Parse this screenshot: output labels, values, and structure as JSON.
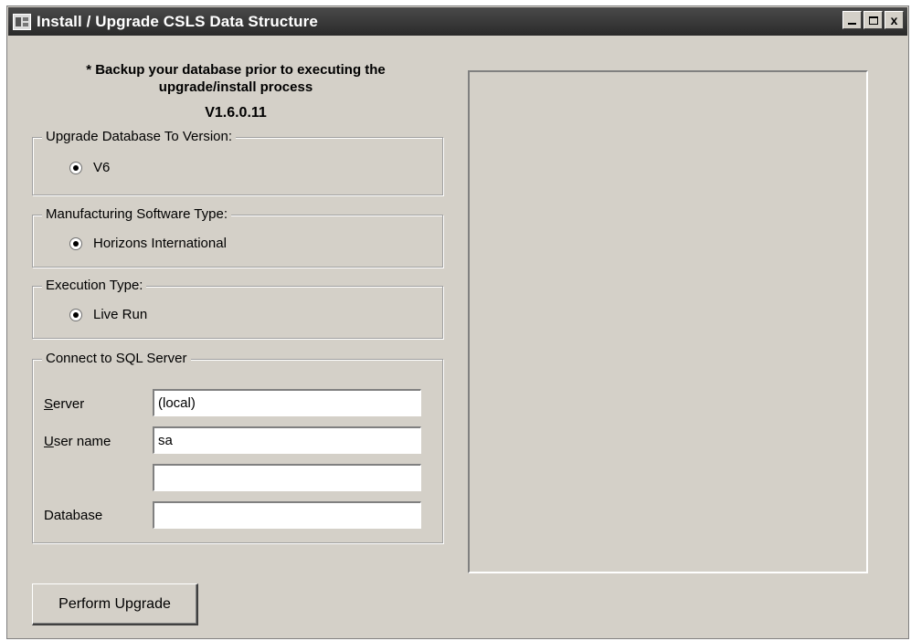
{
  "window": {
    "title": "Install / Upgrade CSLS Data Structure",
    "controls": {
      "minimize": "_",
      "maximize": "□",
      "close": "x"
    }
  },
  "notice": {
    "line1": "* Backup your database prior to executing the",
    "line2": "upgrade/install process"
  },
  "version": "V1.6.0.11",
  "groups": {
    "upgrade_version": {
      "title": "Upgrade Database To Version:",
      "option": "V6",
      "selected": true
    },
    "software_type": {
      "title": "Manufacturing Software Type:",
      "option": "Horizons International",
      "selected": true
    },
    "execution_type": {
      "title": "Execution Type:",
      "option": "Live Run",
      "selected": true
    }
  },
  "sql": {
    "title": "Connect to SQL Server",
    "server_label_accel": "S",
    "server_label_rest": "erver",
    "server_value": "(local)",
    "username_label_accel": "U",
    "username_label_rest": "ser name",
    "username_value": "sa",
    "password_value": "",
    "database_label": "Database",
    "database_value": ""
  },
  "perform_button": "Perform Upgrade",
  "icons": [
    "app-icon",
    "minimize-icon",
    "maximize-icon",
    "close-icon",
    "radio-selected-icon"
  ]
}
